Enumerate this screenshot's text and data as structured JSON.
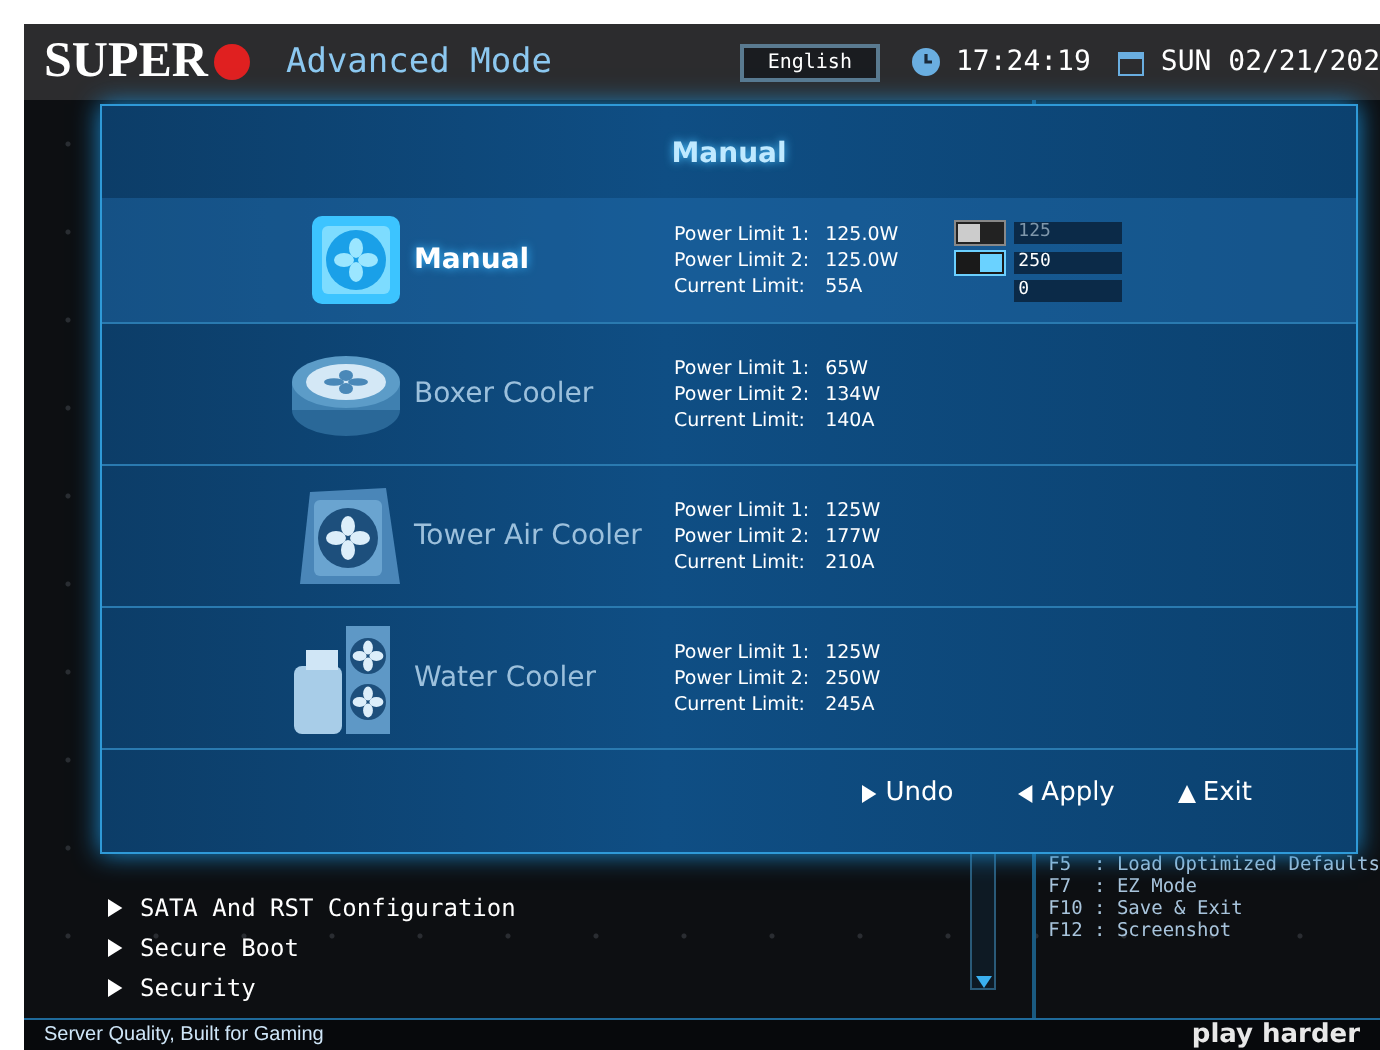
{
  "header": {
    "logo": "SUPER",
    "mode": "Advanced Mode",
    "language": "English",
    "time": "17:24:19",
    "date": "SUN 02/21/202"
  },
  "menu": [
    {
      "label": "SATA And RST Configuration"
    },
    {
      "label": "Secure Boot"
    },
    {
      "label": "Security"
    }
  ],
  "help_keys": [
    "F5  : Load Optimized Defaults",
    "F7  : EZ Mode",
    "F10 : Save & Exit",
    "F12 : Screenshot"
  ],
  "dialog": {
    "title": "Manual",
    "profiles": [
      {
        "kind": "manual",
        "name": "Manual",
        "selected": true,
        "limits": [
          {
            "label": "Power Limit 1:",
            "value": "125.0W"
          },
          {
            "label": "Power Limit 2:",
            "value": "125.0W"
          },
          {
            "label": "Current Limit:",
            "value": "55A"
          }
        ],
        "inputs": [
          {
            "on": false,
            "value": "125"
          },
          {
            "on": true,
            "value": "250"
          },
          {
            "value": "0"
          }
        ]
      },
      {
        "kind": "boxer",
        "name": "Boxer Cooler",
        "selected": false,
        "limits": [
          {
            "label": "Power Limit 1:",
            "value": "65W"
          },
          {
            "label": "Power Limit 2:",
            "value": "134W"
          },
          {
            "label": "Current Limit:",
            "value": "140A"
          }
        ]
      },
      {
        "kind": "tower",
        "name": "Tower Air Cooler",
        "selected": false,
        "limits": [
          {
            "label": "Power Limit 1:",
            "value": "125W"
          },
          {
            "label": "Power Limit 2:",
            "value": "177W"
          },
          {
            "label": "Current Limit:",
            "value": "210A"
          }
        ]
      },
      {
        "kind": "water",
        "name": "Water Cooler",
        "selected": false,
        "limits": [
          {
            "label": "Power Limit 1:",
            "value": "125W"
          },
          {
            "label": "Power Limit 2:",
            "value": "250W"
          },
          {
            "label": "Current Limit:",
            "value": "245A"
          }
        ]
      }
    ],
    "buttons": [
      {
        "kind": "right",
        "label": "Undo"
      },
      {
        "kind": "left",
        "label": "Apply"
      },
      {
        "kind": "up",
        "label": "Exit"
      }
    ]
  },
  "footer": {
    "tagline": "Server Quality, Built for Gaming",
    "brand": "play harder"
  }
}
